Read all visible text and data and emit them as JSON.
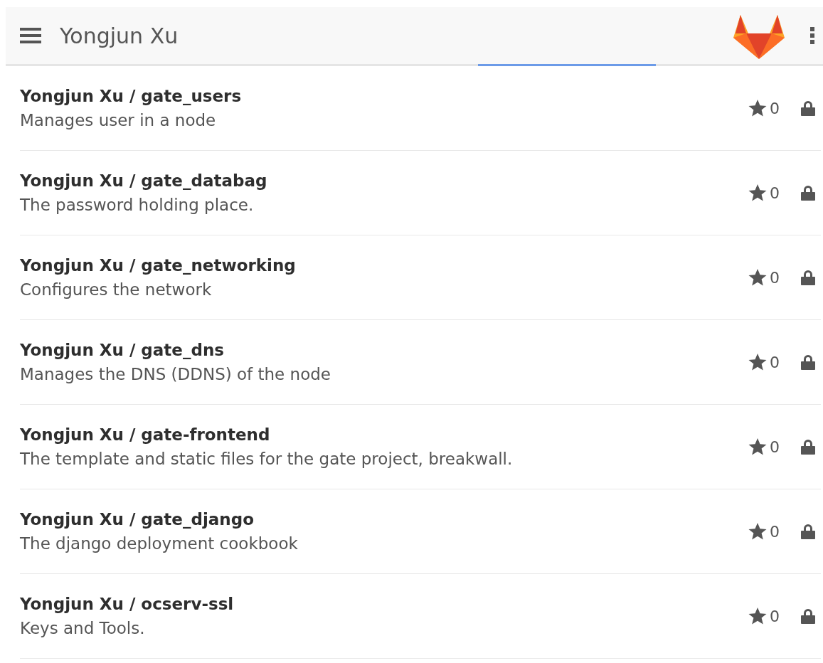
{
  "header": {
    "title": "Yongjun Xu"
  },
  "projects": [
    {
      "name": "Yongjun Xu / gate_users",
      "description": "Manages user in a node",
      "stars_count": "0",
      "private": true
    },
    {
      "name": "Yongjun Xu / gate_databag",
      "description": "The password holding place.",
      "stars_count": "0",
      "private": true
    },
    {
      "name": "Yongjun Xu / gate_networking",
      "description": "Configures the network",
      "stars_count": "0",
      "private": true
    },
    {
      "name": "Yongjun Xu / gate_dns",
      "description": "Manages the DNS (DDNS) of the node",
      "stars_count": "0",
      "private": true
    },
    {
      "name": "Yongjun Xu / gate-frontend",
      "description": "The template and static files for the gate project, breakwall.",
      "stars_count": "0",
      "private": true
    },
    {
      "name": "Yongjun Xu / gate_django",
      "description": "The django deployment cookbook",
      "stars_count": "0",
      "private": true
    },
    {
      "name": "Yongjun Xu / ocserv-ssl",
      "description": "Keys and Tools.",
      "stars_count": "0",
      "private": true
    }
  ]
}
